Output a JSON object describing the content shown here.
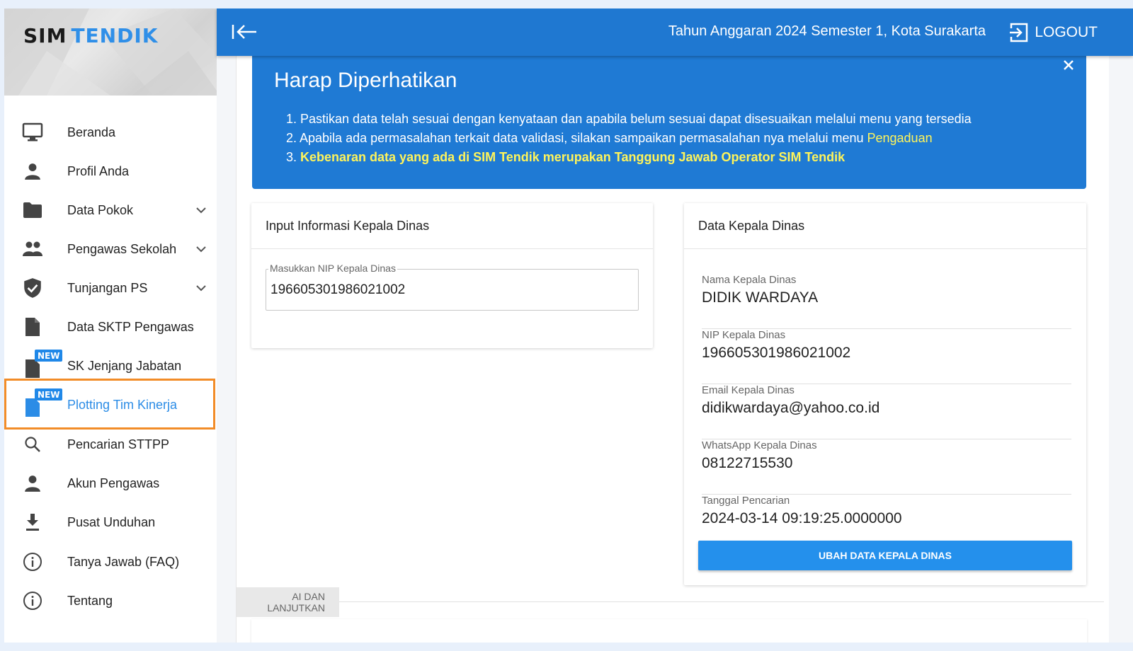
{
  "app": {
    "logo_part1": "SIM",
    "logo_part2": "TENDIK"
  },
  "topbar": {
    "budget_info": "Tahun Anggaran 2024 Semester 1, Kota Surakarta",
    "logout_label": "LOGOUT"
  },
  "sidebar": {
    "items": [
      {
        "label": "Beranda",
        "icon": "monitor-icon"
      },
      {
        "label": "Profil Anda",
        "icon": "person-icon"
      },
      {
        "label": "Data Pokok",
        "icon": "folder-icon",
        "expandable": true
      },
      {
        "label": "Pengawas Sekolah",
        "icon": "people-icon",
        "expandable": true
      },
      {
        "label": "Tunjangan PS",
        "icon": "shield-check-icon",
        "expandable": true
      },
      {
        "label": "Data SKTP Pengawas",
        "icon": "document-icon"
      },
      {
        "label": "SK Jenjang Jabatan",
        "icon": "document-icon",
        "badge": "NEW"
      },
      {
        "label": "Plotting Tim Kinerja",
        "icon": "document-icon",
        "badge": "NEW",
        "active": true
      },
      {
        "label": "Pencarian STTPP",
        "icon": "search-icon"
      },
      {
        "label": "Akun Pengawas",
        "icon": "person-icon"
      },
      {
        "label": "Pusat Unduhan",
        "icon": "download-icon"
      },
      {
        "label": "Tanya Jawab (FAQ)",
        "icon": "info-icon"
      },
      {
        "label": "Tentang",
        "icon": "info-icon"
      }
    ]
  },
  "notice": {
    "title": "Harap Diperhatikan",
    "line1": "1. Pastikan data telah sesuai dengan kenyataan dan apabila belum sesuai dapat disesuaikan melalui menu yang tersedia",
    "line2_prefix": "2. Apabila ada permasalahan terkait data validasi, silakan sampaikan permasalahan nya melalui menu ",
    "line2_link": "Pengaduan",
    "line3_prefix": "3. ",
    "line3_bold": "Kebenaran data yang ada di SIM Tendik merupakan Tanggung Jawab Operator SIM Tendik"
  },
  "input_card": {
    "title": "Input Informasi Kepala Dinas",
    "nip_label": "Masukkan NIP Kepala Dinas",
    "nip_value": "196605301986021002"
  },
  "data_card": {
    "title": "Data Kepala Dinas",
    "fields": [
      {
        "label": "Nama Kepala Dinas",
        "value": "DIDIK WARDAYA"
      },
      {
        "label": "NIP Kepala Dinas",
        "value": "196605301986021002"
      },
      {
        "label": "Email Kepala Dinas",
        "value": "didikwardaya@yahoo.co.id"
      },
      {
        "label": "WhatsApp Kepala Dinas",
        "value": "08122715530"
      },
      {
        "label": "Tanggal Pencarian",
        "value": "2024-03-14 09:19:25.0000000"
      }
    ],
    "button_label": "UBAH DATA KEPALA DINAS"
  },
  "footer": {
    "continue_label": "AI DAN LANJUTKAN"
  },
  "colors": {
    "primary": "#1f78d1",
    "accent_button": "#2490ec",
    "highlight_yellow": "#fff45a",
    "active_outline": "#f28c28",
    "logo_blue": "#2f8fe8"
  }
}
